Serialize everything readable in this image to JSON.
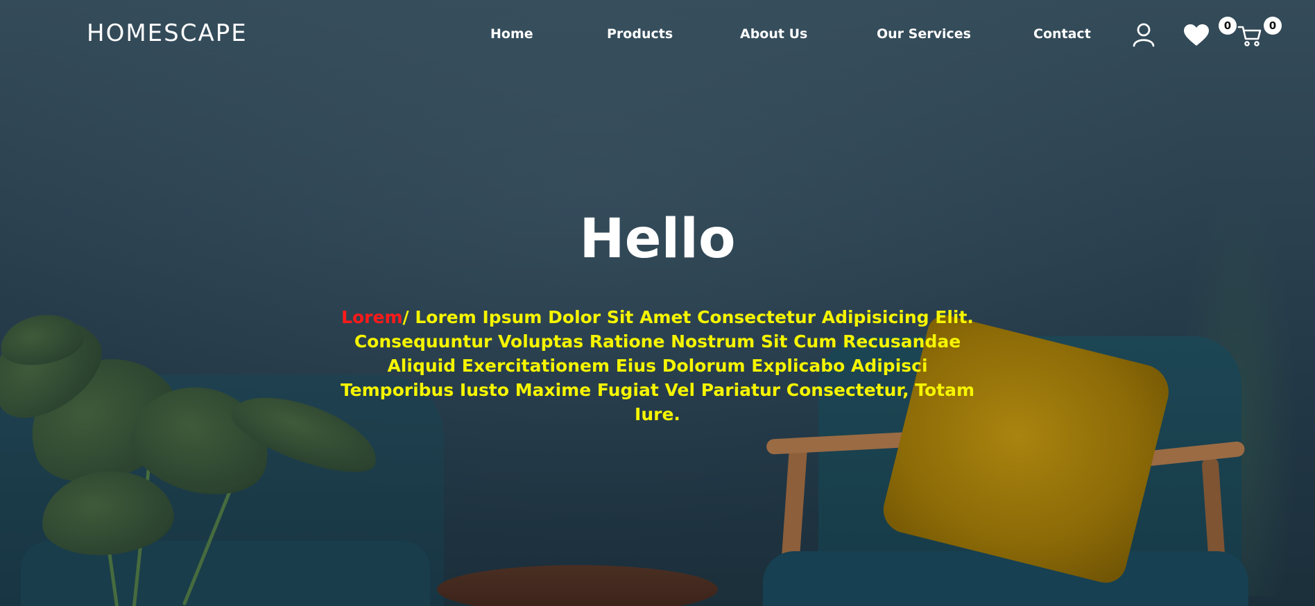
{
  "brand": {
    "name": "HOMESCAPE"
  },
  "nav": {
    "items": [
      {
        "label": "Home"
      },
      {
        "label": "Products"
      },
      {
        "label": "About Us"
      },
      {
        "label": "Our Services"
      },
      {
        "label": "Contact"
      }
    ],
    "icons": {
      "account": "user-icon",
      "wishlist": "heart-icon",
      "cart": "cart-icon"
    },
    "wishlist_count": "0",
    "cart_count": "0"
  },
  "hero": {
    "title": "Hello",
    "text_accent": "Lorem",
    "text_body": "/ Lorem Ipsum Dolor Sit Amet Consectetur Adipisicing Elit. Consequuntur Voluptas Ratione Nostrum Sit Cum Recusandae Aliquid Exercitationem Eius Dolorum Explicabo Adipisci Temporibus Iusto Maxime Fugiat Vel Pariatur Consectetur, Totam Iure."
  },
  "colors": {
    "text_primary": "#ffffff",
    "text_highlight": "#f6f500",
    "text_accent": "#ff1a1a",
    "background": "#2b4150"
  }
}
